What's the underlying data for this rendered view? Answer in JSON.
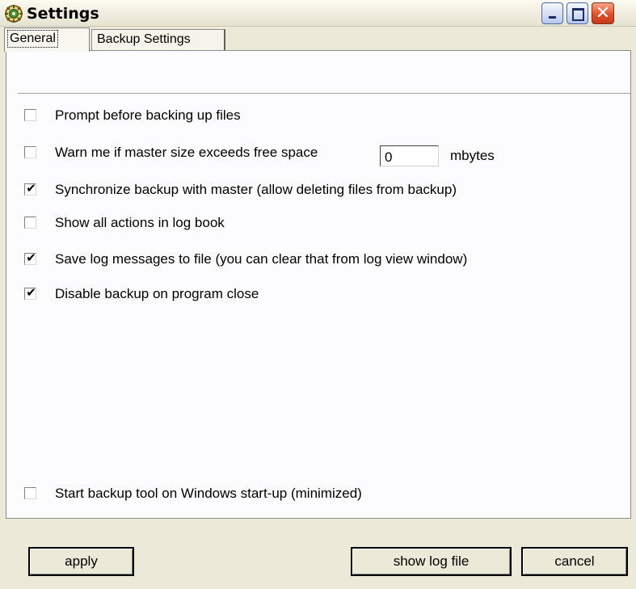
{
  "window": {
    "title": "Settings"
  },
  "tabs": [
    {
      "label": "General",
      "selected": true
    },
    {
      "label": "Backup Settings",
      "selected": false
    }
  ],
  "options": [
    {
      "label": "Prompt before backing up files",
      "checked": false
    },
    {
      "label": "Warn me if master size exceeds free space",
      "checked": false
    },
    {
      "label": "Synchronize backup with master (allow deleting files from backup)",
      "checked": true
    },
    {
      "label": "Show all actions in log book",
      "checked": false
    },
    {
      "label": "Save log messages to file (you can clear that from log view window)",
      "checked": true
    },
    {
      "label": "Disable backup on program close",
      "checked": true
    },
    {
      "label": "Start backup tool on Windows start-up (minimized)",
      "checked": false
    }
  ],
  "free_space": {
    "value": "0",
    "unit": "mbytes"
  },
  "buttons": {
    "apply": "apply",
    "show_log": "show log file",
    "cancel": "cancel"
  },
  "icons": {
    "app": "settings-gear-icon",
    "minimize": "minimize-icon",
    "maximize": "maximize-icon",
    "close": "close-icon",
    "check": "checkmark-icon"
  },
  "colors": {
    "close_button": "#e0502b",
    "title_buttons": "#d3dcf5",
    "dialog_face": "#ece9d8"
  }
}
